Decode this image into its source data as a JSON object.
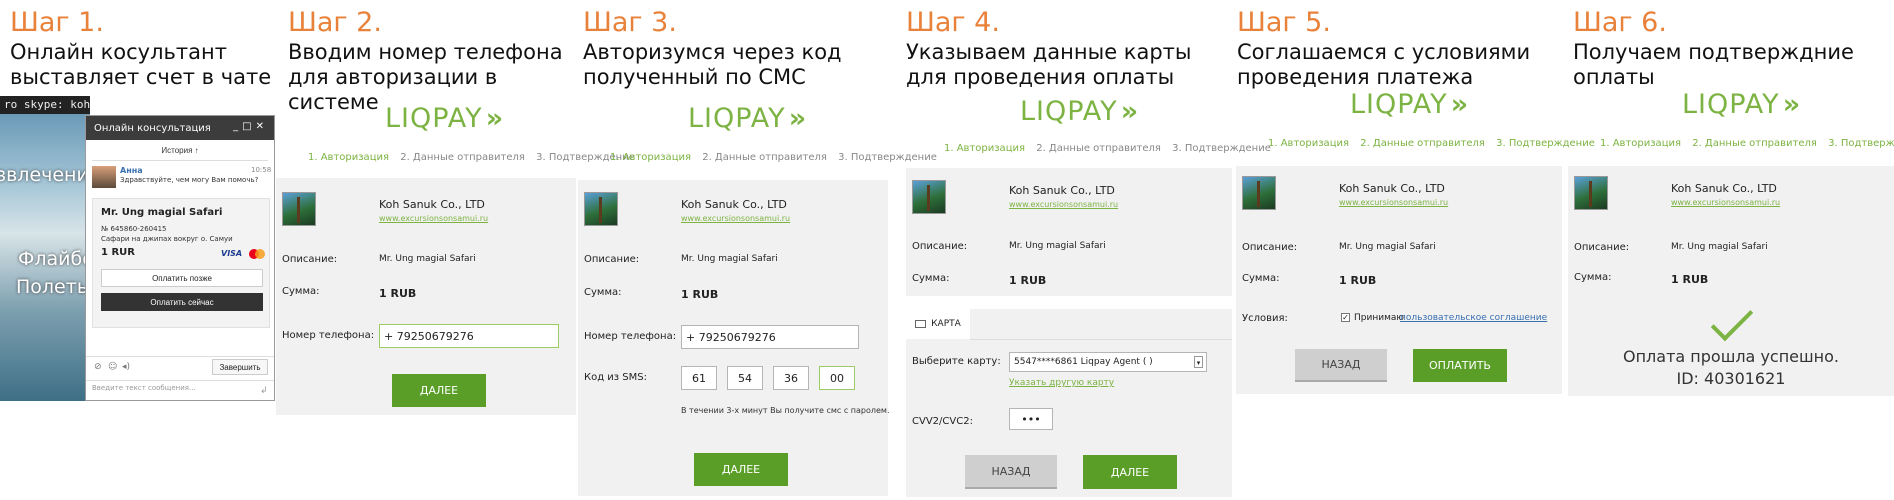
{
  "steps": [
    {
      "title": "Шаг 1.",
      "desc1": "Онлайн косультант",
      "desc2": "выставляет счет в чате"
    },
    {
      "title": "Шаг 2.",
      "desc1": "Вводим номер телефона",
      "desc2": "для авторизации в системе"
    },
    {
      "title": "Шаг 3.",
      "desc1": "Авторизумся через код",
      "desc2": "полученный по СМС"
    },
    {
      "title": "Шаг 4.",
      "desc1": "Указываем данные карты",
      "desc2": "для проведения оплаты"
    },
    {
      "title": "Шаг 5.",
      "desc1": "Соглашаемся с условиями",
      "desc2": "проведения платежа"
    },
    {
      "title": "Шаг 6.",
      "desc1": "Получаем подтверждние",
      "desc2": "оплаты"
    }
  ],
  "logo": "LIQPAY",
  "nav": {
    "step1": "1. Авторизация",
    "step2": "2. Данные отправителя",
    "step3": "3. Подтверждение"
  },
  "merchant": {
    "name": "Koh Sanuk Co., LTD",
    "site": "www.excursionsonsamui.ru"
  },
  "labels": {
    "description": "Описание:",
    "sum": "Сумма:",
    "phone": "Номер телефона:",
    "sms": "Код из SMS:",
    "choose_card": "Выберите карту:",
    "cvv": "CVV2/CVC2:",
    "conditions": "Условия:"
  },
  "description_value": "Mr. Ung magial Safari",
  "amount": "1 RUB",
  "phone_value": "+ 79250679276",
  "sms_codes": [
    "61",
    "54",
    "36",
    "00"
  ],
  "sms_note": "В течении 3-х минут Вы получите смс с паролем.",
  "card_tab": "КАРТА",
  "card_value": "5547****6861 Liqpay Agent ( )",
  "other_card": "Указать другую карту",
  "cvv_value": "•••",
  "accept_prefix": "Принимаю",
  "accept_link": "пользовательское соглашение",
  "buttons": {
    "next": "ДАЛЕЕ",
    "back": "НАЗАД",
    "pay": "ОПЛАТИТЬ"
  },
  "success": {
    "line1": "Оплата прошла успешно.",
    "line2": "ID: 40301621"
  },
  "chat": {
    "skype": "ro skype: kohsanuk",
    "bg1": "звлечени",
    "bg2": "Флайбор",
    "bg3": "Полеты",
    "title": "Онлайн консультация",
    "history": "История ↑",
    "agent": "Анна",
    "time": "10:58",
    "greeting": "Здравствуйте, чем могу Вам помочь?",
    "invoice_title": "Mr. Ung magial Safari",
    "invoice_no": "№ 645860-260415",
    "invoice_desc": "Сафари на джипах вокруг о. Самуи",
    "invoice_amount": "1 RUR",
    "pay_later": "Оплатить позже",
    "pay_now": "Оплатить сейчас",
    "finish": "Завершить",
    "placeholder": "Введите текст сообщения..."
  }
}
